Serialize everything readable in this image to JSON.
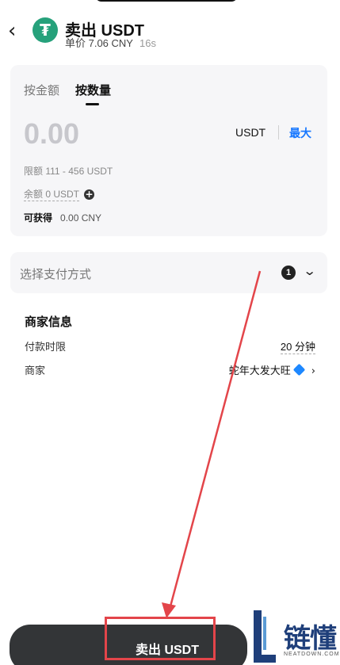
{
  "header": {
    "back_icon": "chevron-left-icon",
    "coin_icon": "tether-icon",
    "coin_symbol": "₮",
    "title": "卖出 USDT",
    "price": "单价 7.06 CNY",
    "timer": "16s"
  },
  "order": {
    "tabs": [
      {
        "label": "按金额",
        "active": false
      },
      {
        "label": "按数量",
        "active": true
      }
    ],
    "amount_placeholder": "0.00",
    "unit": "USDT",
    "max_label": "最大",
    "limit_text": "限额 111 - 456 USDT",
    "balance_text": "余额 0 USDT",
    "add_icon": "plus-circle-icon",
    "receive_label": "可获得",
    "receive_value": "0.00 CNY"
  },
  "payment": {
    "label": "选择支付方式",
    "count": "1",
    "expand_icon": "chevron-down-icon"
  },
  "merchant": {
    "title": "商家信息",
    "rows": [
      {
        "label": "付款时限",
        "value": "20 分钟"
      },
      {
        "label": "商家",
        "value": "蛇年大发大旺",
        "badge_icon": "verified-diamond-icon"
      }
    ]
  },
  "footer": {
    "sell_label": "卖出 USDT"
  },
  "watermark": {
    "brand": "链懂",
    "sub": "NEATDOWN.COM"
  },
  "colors": {
    "accent_blue": "#1476ff",
    "tether_green": "#26a17b",
    "annotation_red": "#e3454a",
    "button_dark": "#333537"
  }
}
